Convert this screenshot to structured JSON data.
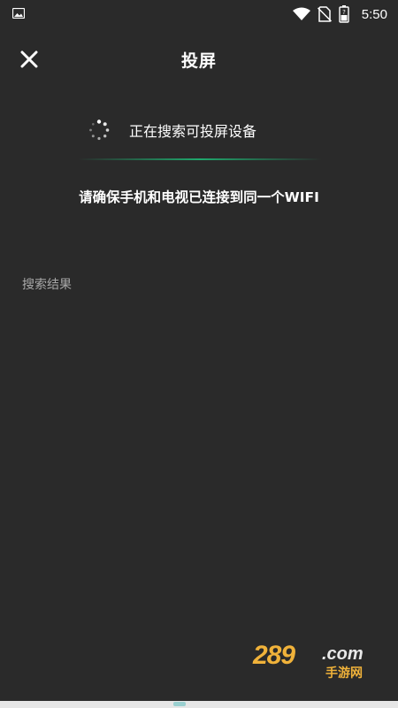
{
  "status_bar": {
    "time": "5:50",
    "icons": [
      "image-icon",
      "wifi-icon",
      "no-sim-icon",
      "battery-icon"
    ]
  },
  "header": {
    "title": "投屏",
    "close_icon": "close-icon"
  },
  "search": {
    "status": "正在搜索可投屏设备",
    "accent_color": "#1fa86d"
  },
  "hint": "请确保手机和电视已连接到同一个WIFI",
  "results": {
    "label": "搜索结果"
  },
  "watermark": {
    "number": "289",
    "domain": ".com",
    "subtitle": "手游网"
  }
}
